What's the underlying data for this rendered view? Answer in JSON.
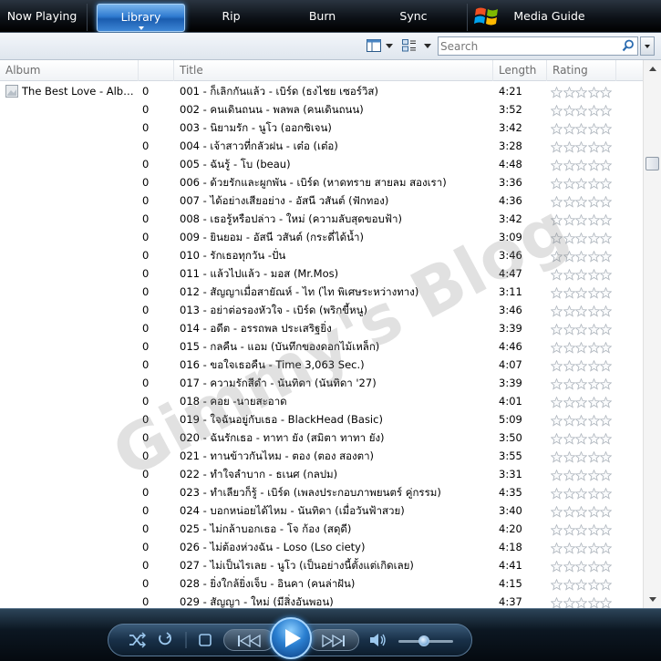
{
  "nav": {
    "now_playing": "Now Playing",
    "library": "Library",
    "rip": "Rip",
    "burn": "Burn",
    "sync": "Sync",
    "media_guide": "Media Guide"
  },
  "search": {
    "placeholder": "Search",
    "value": ""
  },
  "columns": {
    "album": "Album",
    "title": "Title",
    "length": "Length",
    "rating": "Rating"
  },
  "album_name": "The Best Love - Albu...",
  "tracks": [
    {
      "num": "0",
      "title": "001 - ก็เลิกกันแล้ว - เบิร์ด (ธงไชย เซอร์วิส)",
      "length": "4:21"
    },
    {
      "num": "0",
      "title": "002 - คนเดินถนน - พลพล (คนเดินถนน)",
      "length": "3:52"
    },
    {
      "num": "0",
      "title": "003 - นิยามรัก - นูโว (ออกซิเจน)",
      "length": "3:42"
    },
    {
      "num": "0",
      "title": "004 - เจ้าสาวที่กลัวฝน - เต๋อ (เต๋อ)",
      "length": "3:28"
    },
    {
      "num": "0",
      "title": "005 - ฉันรู้ - โบ (beau)",
      "length": "4:48"
    },
    {
      "num": "0",
      "title": "006 - ด้วยรักและผูกพัน - เบิร์ด (หาดทราย สายลม สองเรา)",
      "length": "3:36"
    },
    {
      "num": "0",
      "title": "007 - ได้อย่างเสียอย่าง - อัสนี วสันต์ (ฟักทอง)",
      "length": "4:36"
    },
    {
      "num": "0",
      "title": "008 - เธอรู้หรือปล่าว - ใหม่ (ความลับสุดขอบฟ้า)",
      "length": "3:42"
    },
    {
      "num": "0",
      "title": "009 - ยินยอม - อัสนี วสันต์ (กระดี่ได้น้ำ)",
      "length": "3:09"
    },
    {
      "num": "0",
      "title": "010 - รักเธอทุกวัน -ปั่น",
      "length": "3:46"
    },
    {
      "num": "0",
      "title": "011 - แล้วไปแล้ว - มอส (Mr.Mos)",
      "length": "4:47"
    },
    {
      "num": "0",
      "title": "012 - สัญญาเมื่อสายัณห์ - ไท (ไท พิเศษระหว่างทาง)",
      "length": "3:11"
    },
    {
      "num": "0",
      "title": "013 - อย่าต่อรองหัวใจ - เบิร์ด (พริกขี้หนู)",
      "length": "3:46"
    },
    {
      "num": "0",
      "title": "014 - อดีต - อรรถพล ประเสริฐยิ่ง",
      "length": "3:39"
    },
    {
      "num": "0",
      "title": "015 - กลคืน - แอม (บันทึกของดอกไม้เหล็ก)",
      "length": "4:46"
    },
    {
      "num": "0",
      "title": "016 - ขอใจเธอคืน - Time 3,063 Sec.)",
      "length": "4:07"
    },
    {
      "num": "0",
      "title": "017 - ความรักสีดำ - นันทิดา (นันทิดา '27)",
      "length": "3:39"
    },
    {
      "num": "0",
      "title": "018 - คอย -นายสะอาด",
      "length": "4:01"
    },
    {
      "num": "0",
      "title": "019 - ใจฉันอยู่กับเธอ - BlackHead (Basic)",
      "length": "5:09"
    },
    {
      "num": "0",
      "title": "020 - ฉันรักเธอ - ทาทา ยัง (สมิตา ทาทา ยัง)",
      "length": "3:50"
    },
    {
      "num": "0",
      "title": "021 - ทานข้าวกันไหม - ตอง (ตอง สองตา)",
      "length": "3:55"
    },
    {
      "num": "0",
      "title": "022 - ทำใจลำบาก - ธเนศ (กลปม)",
      "length": "3:31"
    },
    {
      "num": "0",
      "title": "023 - ทำเลียวก็รู้ - เบิร์ด (เพลงประกอบภาพยนตร์ คู่กรรม)",
      "length": "4:35"
    },
    {
      "num": "0",
      "title": "024 - บอกหน่อยได้ไหม - นันทิดา (เมื่อวันฟ้าสวย)",
      "length": "3:40"
    },
    {
      "num": "0",
      "title": "025 - ไม่กล้าบอกเธอ - โจ ก้อง (สดุดี)",
      "length": "4:20"
    },
    {
      "num": "0",
      "title": "026 - ไม่ต้องห่วงฉัน - Loso (Lso ciety)",
      "length": "4:18"
    },
    {
      "num": "0",
      "title": "027 - ไม่เป็นไรเลย - นูโว (เป็นอย่างนี้ตั้งแต่เกิดเลย)",
      "length": "4:41"
    },
    {
      "num": "0",
      "title": "028 - ยิ่งใกล้ยิ่งเจ็บ - อินคา (คนล่าฝัน)",
      "length": "4:15"
    },
    {
      "num": "0",
      "title": "029 - สัญญา - ใหม่ (มีสิ่งอันพอน)",
      "length": "4:37"
    }
  ],
  "watermark": "Gimmy's Blog",
  "colors": {
    "accent": "#2f7bd0",
    "star_empty": "#c8cdd3"
  }
}
